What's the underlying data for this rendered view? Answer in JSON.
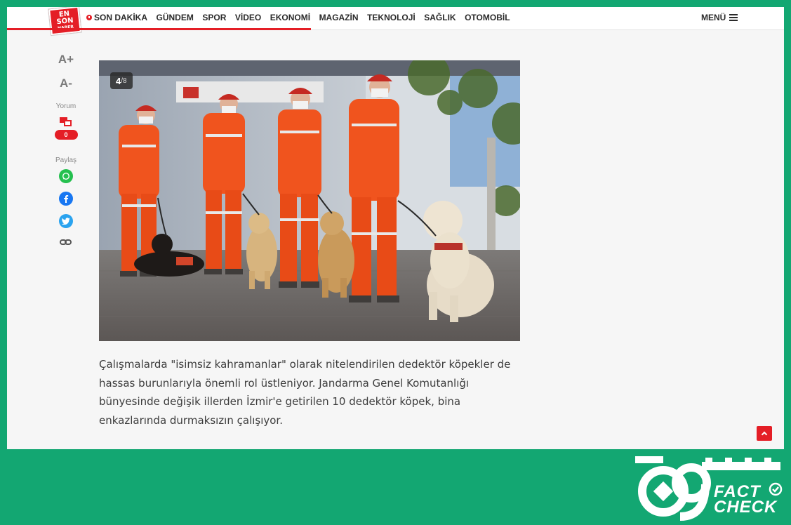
{
  "header": {
    "logo": {
      "line1": "EN",
      "line2": "SON",
      "line3": "HABER"
    },
    "nav": [
      {
        "label": "SON DAKİKA",
        "live": true
      },
      {
        "label": "GÜNDEM"
      },
      {
        "label": "SPOR"
      },
      {
        "label": "VİDEO"
      },
      {
        "label": "EKONOMİ"
      },
      {
        "label": "MAGAZİN"
      },
      {
        "label": "TEKNOLOJİ"
      },
      {
        "label": "SAĞLIK"
      },
      {
        "label": "OTOMOBİL"
      }
    ],
    "menu_label": "MENÜ"
  },
  "tools": {
    "font_increase": "A+",
    "font_decrease": "A-",
    "comment_label": "Yorum",
    "comment_count": "0",
    "share_label": "Paylaş",
    "share_icons": [
      "whatsapp-icon",
      "facebook-icon",
      "twitter-icon",
      "link-icon"
    ]
  },
  "gallery": {
    "current": "4",
    "total": "/8"
  },
  "article": {
    "paragraph": "Çalışmalarda \"isimsiz kahramanlar\" olarak nitelendirilen dedektör köpekler de hassas burunlarıyla önemli rol üstleniyor. Jandarma Genel Komutanlığı bünyesinde değişik illerden İzmir'e getirilen 10 dedektör köpek, bina enkazlarında durmaksızın çalışıyor."
  },
  "watermark": {
    "number": "09",
    "line1": "FACT",
    "line2": "CHECK"
  },
  "colors": {
    "brand_red": "#e41e26",
    "page_green": "#13a772",
    "uniform_orange": "#f0541e"
  }
}
